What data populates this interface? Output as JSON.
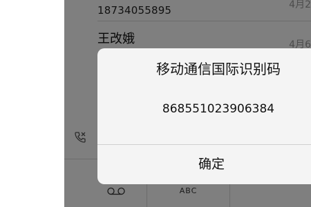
{
  "call_list": {
    "row1": {
      "number": "18734055895",
      "date": "4月2"
    },
    "row2": {
      "name": "王改娥",
      "date": "4月6"
    }
  },
  "keypad": {
    "key2_letters": "ABC"
  },
  "dialog": {
    "title": "移动通信国际识别码",
    "message": "868551023906384",
    "confirm_label": "确定"
  },
  "colors": {
    "overlay": "#000000",
    "dialog_bg": "#f4f4f4",
    "text": "#111111"
  },
  "icons": [
    "phone-call-icon",
    "voicemail-icon"
  ]
}
